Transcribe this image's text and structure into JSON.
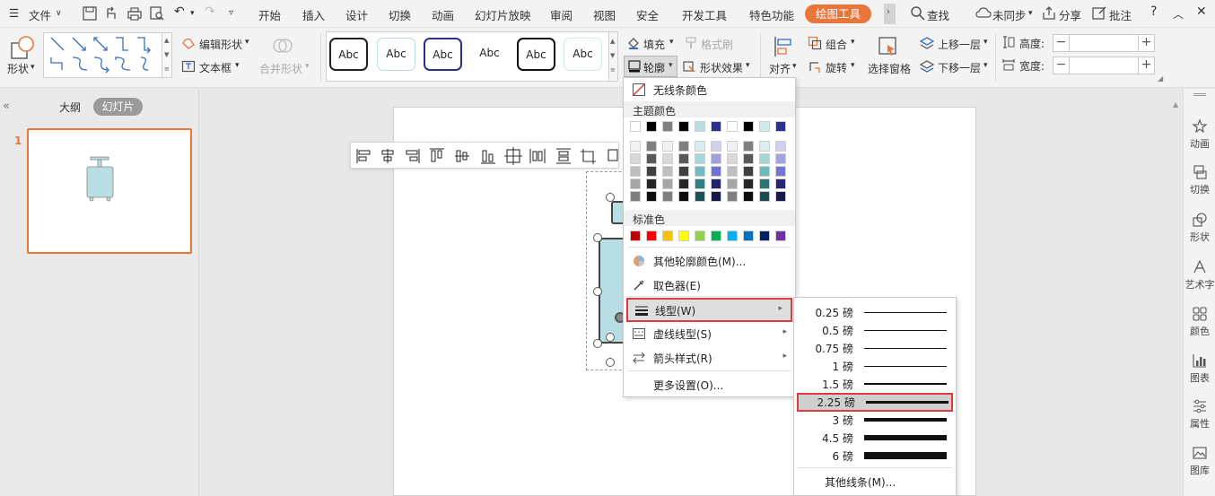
{
  "menubar": {
    "file_label": "文件",
    "tabs": [
      "开始",
      "插入",
      "设计",
      "切换",
      "动画",
      "幻灯片放映",
      "审阅",
      "视图",
      "安全",
      "开发工具",
      "特色功能"
    ],
    "active_tab": "绘图工具",
    "search_label": "查找",
    "sync_label": "未同步",
    "share_label": "分享",
    "comment_label": "批注",
    "help_label": "?"
  },
  "ribbon": {
    "shape_label": "形状",
    "edit_shape_label": "编辑形状",
    "textbox_label": "文本框",
    "merge_shape_label": "合并形状",
    "style_samples": [
      "Abc",
      "Abc",
      "Abc",
      "Abc",
      "Abc",
      "Abc"
    ],
    "fill_label": "填充",
    "format_brush_label": "格式刷",
    "outline_label": "轮廓",
    "shape_effect_label": "形状效果",
    "align_label": "对齐",
    "group_label": "组合",
    "rotate_label": "旋转",
    "selection_pane_label": "选择窗格",
    "bring_forward_label": "上移一层",
    "send_backward_label": "下移一层",
    "height_label": "高度:",
    "width_label": "宽度:",
    "height_value": "",
    "width_value": "",
    "minus": "−",
    "plus": "+"
  },
  "leftpanel": {
    "collapse": "«",
    "tab_outline": "大纲",
    "tab_slides": "幻灯片",
    "slide_number": "1"
  },
  "outline_menu": {
    "no_line": "无线条颜色",
    "theme_colors_title": "主题颜色",
    "theme_top": [
      "#ffffff",
      "#000000",
      "#7f7f7f",
      "#000000",
      "#b8dde3",
      "#2e2e8c",
      "#ffffff",
      "#000000",
      "#d0eaea",
      "#2f2f8f"
    ],
    "theme_shades": [
      [
        "#f2f2f2",
        "#7f7f7f",
        "#f2f2f2",
        "#7f7f7f",
        "#d9eef1",
        "#cfcff0",
        "#f2f2f2",
        "#7f7f7f",
        "#dcefef",
        "#d0d0f0"
      ],
      [
        "#d9d9d9",
        "#595959",
        "#d9d9d9",
        "#595959",
        "#a8d8dc",
        "#a0a0e0",
        "#d9d9d9",
        "#595959",
        "#a5d5d5",
        "#a3a3e2"
      ],
      [
        "#bfbfbf",
        "#404040",
        "#bfbfbf",
        "#404040",
        "#70bcc4",
        "#7070d0",
        "#bfbfbf",
        "#404040",
        "#6fbaba",
        "#7676d2"
      ],
      [
        "#a6a6a6",
        "#262626",
        "#a6a6a6",
        "#262626",
        "#2f7f86",
        "#24246e",
        "#a6a6a6",
        "#262626",
        "#2d7474",
        "#252572"
      ],
      [
        "#7f7f7f",
        "#0d0d0d",
        "#7f7f7f",
        "#0d0d0d",
        "#1f5257",
        "#171748",
        "#7f7f7f",
        "#0d0d0d",
        "#1c4a4a",
        "#18184a"
      ]
    ],
    "standard_colors_title": "标准色",
    "standard_colors": [
      "#c00000",
      "#ff0000",
      "#ffc000",
      "#ffff00",
      "#92d050",
      "#00b050",
      "#00b0f0",
      "#0070c0",
      "#002060",
      "#7030a0"
    ],
    "more_colors": "其他轮廓颜色(M)...",
    "eyedropper": "取色器(E)",
    "line_style": "线型(W)",
    "dash_style": "虚线线型(S)",
    "arrow_style": "箭头样式(R)",
    "more_settings": "更多设置(O)..."
  },
  "line_weight_menu": {
    "items": [
      "0.25 磅",
      "0.5 磅",
      "0.75 磅",
      "1 磅",
      "1.5 磅",
      "2.25 磅",
      "3 磅",
      "4.5 磅",
      "6 磅"
    ],
    "weights_pt": [
      0.25,
      0.5,
      0.75,
      1,
      1.5,
      2.25,
      3,
      4.5,
      6
    ],
    "selected": "2.25 磅",
    "more_lines": "其他线条(M)..."
  },
  "rightpanel": {
    "items": [
      "动画",
      "切换",
      "形状",
      "艺术字",
      "颜色",
      "图表",
      "属性",
      "图库"
    ]
  },
  "colors": {
    "accent": "#e8763a",
    "highlight_border": "#e0393e",
    "shape_fill": "#b8dde3"
  }
}
